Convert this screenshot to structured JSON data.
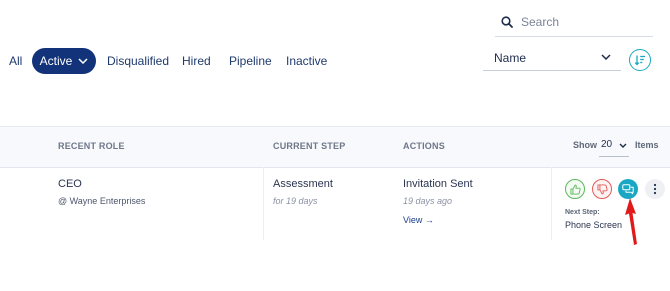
{
  "search": {
    "placeholder": "Search",
    "value": ""
  },
  "tabs": [
    {
      "label": "All"
    },
    {
      "label": "Active",
      "selected": true
    },
    {
      "label": "Disqualified"
    },
    {
      "label": "Hired"
    },
    {
      "label": "Pipeline"
    },
    {
      "label": "Inactive"
    }
  ],
  "sort": {
    "selected": "Name"
  },
  "table": {
    "headers": {
      "recent_role": "RECENT ROLE",
      "current_step": "CURRENT STEP",
      "actions": "ACTIONS"
    },
    "show_label": "Show",
    "items_label": "Items",
    "page_size": "20",
    "rows": [
      {
        "role": "CEO",
        "company": "@ Wayne Enterprises",
        "step": "Assessment",
        "step_duration": "for 19 days",
        "action": "Invitation Sent",
        "action_time": "19 days ago",
        "view_label": "View →",
        "next_step_label": "Next Step:",
        "next_step_value": "Phone Screen"
      }
    ]
  },
  "colors": {
    "brand": "#12337a",
    "accent": "#1aa7c4",
    "approve": "#5cb85c",
    "reject": "#e25a5a",
    "annotation": "#e0191b"
  },
  "icons": [
    "search-icon",
    "chevron-down-icon",
    "sort-filter-icon",
    "thumbs-up-icon",
    "thumbs-down-icon",
    "chat-icon",
    "more-vertical-icon",
    "arrow-annotation"
  ]
}
